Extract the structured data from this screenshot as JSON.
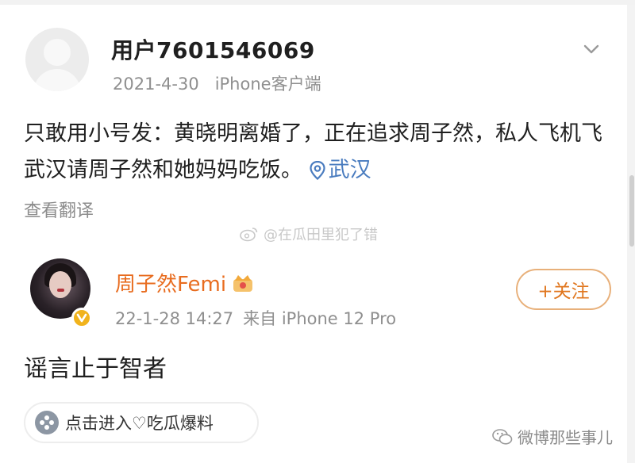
{
  "post": {
    "username": "用户7601546069",
    "date": "2021-4-30",
    "source": "iPhone客户端",
    "text": "只敢用小号发：黄晓明离婚了，正在追求周子然，私人飞机飞武汉请周子然和她妈妈吃饭。",
    "location": "武汉",
    "translate_label": "查看翻译"
  },
  "watermark": {
    "text": "@在瓜田里犯了错"
  },
  "comment": {
    "name": "周子然Femi",
    "date": "22-1-28 14:27",
    "source": "来自 iPhone 12 Pro",
    "follow_label": "+关注",
    "text": "谣言止于智者",
    "verified_color": "#f1b31c"
  },
  "chip": {
    "label": "点击进入♡吃瓜爆料"
  },
  "footer": {
    "label": "微博那些事儿"
  },
  "colors": {
    "name_orange": "#e86c1f",
    "link_blue": "#4a7cbf",
    "meta_gray": "#8f8f8f"
  }
}
